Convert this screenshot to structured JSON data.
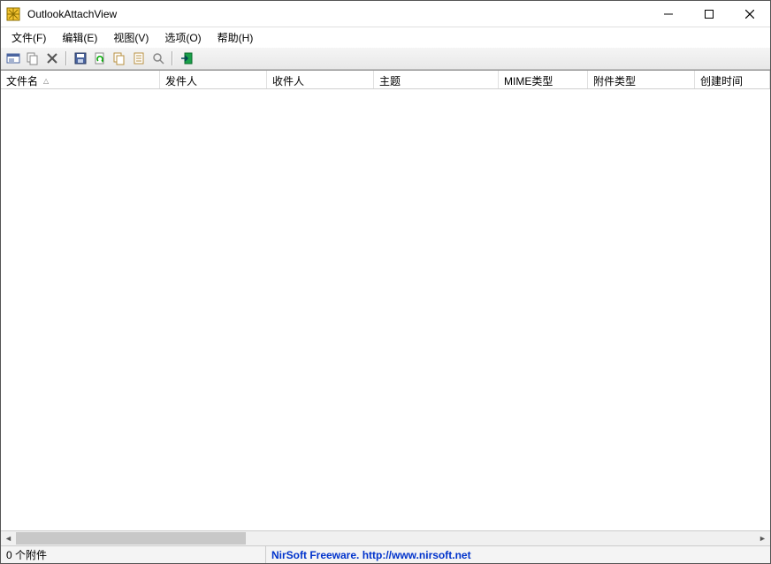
{
  "title": "OutlookAttachView",
  "menu": {
    "file": "文件(F)",
    "edit": "编辑(E)",
    "view": "视图(V)",
    "options": "选项(O)",
    "help": "帮助(H)"
  },
  "toolbar_icons": {
    "scan": "scan-options",
    "copy": "copy",
    "delete": "delete",
    "save": "save",
    "refresh": "refresh",
    "copy_cell": "copy-cell",
    "properties": "properties",
    "find": "find",
    "exit": "exit"
  },
  "columns": {
    "filename": "文件名",
    "from": "发件人",
    "to": "收件人",
    "subject": "主题",
    "mime": "MIME类型",
    "attach_type": "附件类型",
    "created": "创建时间"
  },
  "status": {
    "count": "0 个附件",
    "credit": "NirSoft Freeware. http://www.nirsoft.net"
  }
}
